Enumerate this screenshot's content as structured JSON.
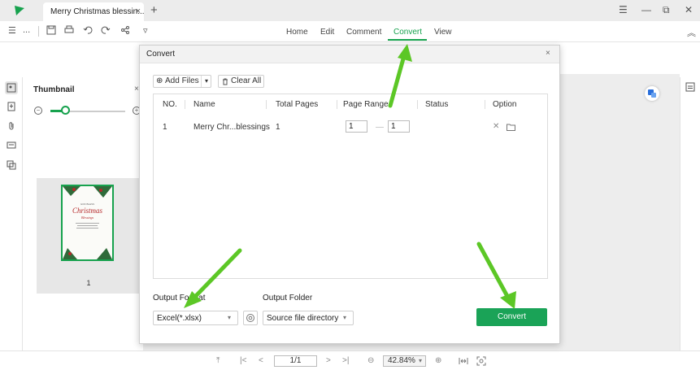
{
  "app": {
    "tab_title": "Merry Christmas blessin...",
    "tab_close": "×",
    "new_tab": "+"
  },
  "window_controls": {
    "menu": "☰",
    "minimize": "—",
    "restore": "⧉",
    "close": "✕"
  },
  "toolbar": {
    "menu_icon": "☰",
    "more": "...",
    "dropdown": "▿",
    "collapse": "︽"
  },
  "menu": {
    "items": [
      "Home",
      "Edit",
      "Comment",
      "Convert",
      "View"
    ],
    "active": "Convert"
  },
  "thumbnail_panel": {
    "title": "Thumbnail",
    "close": "×",
    "page_number": "1",
    "zoom_minus": "−",
    "zoom_plus": "+",
    "slider_level": 0.2,
    "thumbnail_small_label": "GOD BLESS",
    "thumbnail_heading": "Christmas",
    "thumbnail_script": "Blessings"
  },
  "dialog": {
    "title": "Convert",
    "close": "×",
    "add_files": "Add Files",
    "add_files_icon": "⊕",
    "add_files_dropdown": "▾",
    "clear_all": "Clear All",
    "clear_all_icon": "🗑",
    "columns": [
      "NO.",
      "Name",
      "Total Pages",
      "Page Range",
      "Status",
      "Option"
    ],
    "rows": [
      {
        "no": "1",
        "name": "Merry Chr...blessings",
        "total_pages": "1",
        "range_from": "1",
        "range_to": "1",
        "status": "",
        "delete_icon": "✕",
        "folder_icon": "folder-icon"
      }
    ],
    "output_format_label": "Output Format",
    "output_format_value": "Excel(*.xlsx)",
    "output_folder_label": "Output Folder",
    "output_folder_value": "Source file directory",
    "caret": "▾",
    "convert_button": "Convert"
  },
  "statusbar": {
    "first_page": "⤒",
    "prev_page": "<",
    "first": "|<",
    "page_display": "1/1",
    "next_page": ">",
    "last": ">|",
    "zoom_out": "⊖",
    "zoom_value": "42.84%",
    "zoom_caret": "▾",
    "zoom_in": "⊕"
  },
  "colors": {
    "accent": "#17a24e",
    "arrow": "#5cc726",
    "convert_button": "#1aa357"
  }
}
